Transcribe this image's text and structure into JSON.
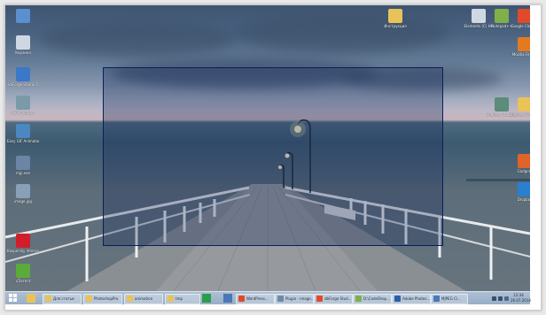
{
  "desktop_icons_left": [
    {
      "name": "this-pc",
      "icon": "computer-icon",
      "label": "",
      "color": "#5a8fd0"
    },
    {
      "name": "recycle-bin",
      "icon": "recycle-bin-icon",
      "label": "Корзина",
      "color": "#cfd8e2"
    },
    {
      "name": "bbforge-studio",
      "icon": "bbforge-icon",
      "label": "vbForge Studio 5",
      "color": "#3a78c8"
    },
    {
      "name": "gif-animator",
      "icon": "gif-animator-icon",
      "label": "GIF Animator",
      "color": "#7a9aa8"
    },
    {
      "name": "easy-gif-animator",
      "icon": "easy-gif-animator-icon",
      "label": "Easy GIF Animator",
      "color": "#4b88c2"
    },
    {
      "name": "shortcut-1",
      "icon": "shortcut-icon",
      "label": "mjp.exe",
      "color": "#6c85a4"
    },
    {
      "name": "image-jpg",
      "icon": "image-file-icon",
      "label": "image.jpg",
      "color": "#8aa0b8"
    },
    {
      "name": "kaspersky",
      "icon": "kaspersky-icon",
      "label": "Kaspersky Internet...",
      "color": "#d21e2a"
    },
    {
      "name": "utorrent",
      "icon": "utorrent-icon",
      "label": "uTorrent",
      "color": "#5bab3a"
    }
  ],
  "desktop_icons_top": [
    {
      "name": "folder-top-center",
      "icon": "folder-icon",
      "label": "Инструкция",
      "color": "#e9c25a"
    },
    {
      "name": "elements-hc",
      "icon": "elements-icon",
      "label": "Elements (C) HC",
      "color": "#cfd8e2"
    },
    {
      "name": "notepad-pp",
      "icon": "notepad-icon",
      "label": "Notepad++",
      "color": "#7fb04a"
    },
    {
      "name": "google-chrome",
      "icon": "chrome-icon",
      "label": "Google Chrome",
      "color": "#e04a2a"
    }
  ],
  "desktop_icons_right": [
    {
      "name": "mozilla-firefox",
      "icon": "firefox-icon",
      "label": "Mozilla Firefox",
      "color": "#e47a1e"
    },
    {
      "name": "onepass-complete-1",
      "icon": "onepass-icon",
      "label": "OnePass Complete",
      "color": "#5c8c7a"
    },
    {
      "name": "onepass-complete-2",
      "icon": "folder-icon",
      "label": "OnePass Complete",
      "color": "#e9c25a"
    },
    {
      "name": "gear-app",
      "icon": "app-icon",
      "label": "Gadgets",
      "color": "#e0642a"
    },
    {
      "name": "dropbox",
      "icon": "dropbox-icon",
      "label": "Dropbox",
      "color": "#2a7fd0"
    }
  ],
  "taskbar": {
    "pinned": [
      {
        "name": "file-explorer",
        "icon": "folder-icon",
        "color": "#e9c25a"
      },
      {
        "name": "store",
        "icon": "store-icon",
        "color": "#2a9e4a"
      },
      {
        "name": "pinned-app",
        "icon": "app-icon",
        "color": "#4a78b8"
      }
    ],
    "buttons": [
      {
        "name": "task-1",
        "icon": "folder-icon",
        "label": "Для статьи",
        "color": "#e9c25a"
      },
      {
        "name": "task-2",
        "icon": "folder-icon",
        "label": "PhotoshopPro",
        "color": "#e9c25a"
      },
      {
        "name": "task-3",
        "icon": "folder-icon",
        "label": "animation",
        "color": "#e9c25a"
      },
      {
        "name": "task-4",
        "icon": "folder-icon",
        "label": "tmp",
        "color": "#e9c25a"
      },
      {
        "name": "task-5",
        "icon": "chrome-icon",
        "label": "WordPress...",
        "color": "#e04a2a"
      },
      {
        "name": "task-6",
        "icon": "image-icon",
        "label": "Plugin - image...",
        "color": "#6f8aa6"
      },
      {
        "name": "task-7",
        "icon": "chrome-icon",
        "label": "dbForge Stud...",
        "color": "#e04a2a"
      },
      {
        "name": "task-8",
        "icon": "notepad-icon",
        "label": "D:\\CodeShop...",
        "color": "#7fb04a"
      },
      {
        "name": "task-9",
        "icon": "photoshop-icon",
        "label": "Adobe Photos...",
        "color": "#2a5fa8"
      },
      {
        "name": "task-10",
        "icon": "app-icon",
        "label": "MJPEG Cl...",
        "color": "#4a78b8"
      }
    ],
    "clock": {
      "time": "12:34",
      "date": "26.07.2014"
    }
  },
  "selection": {
    "state": "active"
  }
}
